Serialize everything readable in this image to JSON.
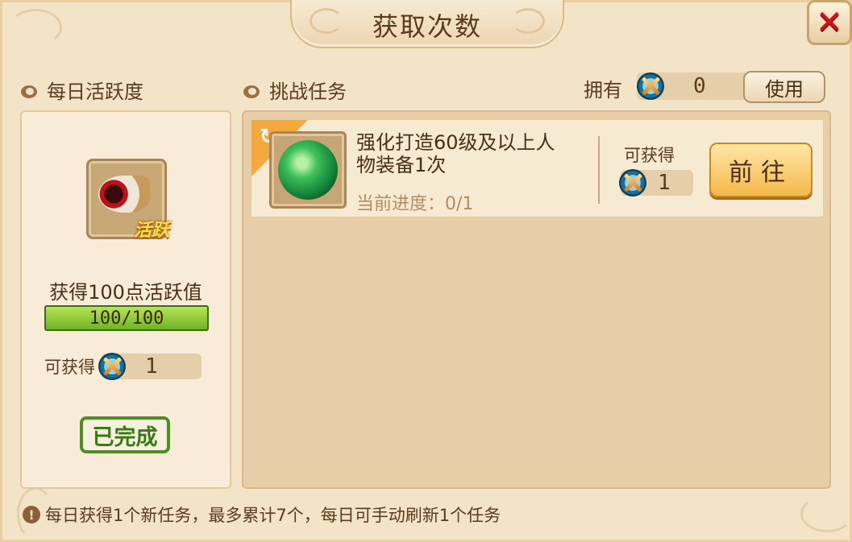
{
  "window": {
    "title": "获取次数",
    "close_icon": "close-icon"
  },
  "left_panel": {
    "header": "每日活跃度",
    "reward_icon_tag": "活跃",
    "reward_title": "获得100点活跃值",
    "progress": {
      "text": "100/100",
      "value": 100,
      "max": 100
    },
    "gain_label": "可获得",
    "gain_value": "1",
    "status_button": "已完成"
  },
  "right_panel": {
    "header": "挑战任务",
    "own_label": "拥有",
    "own_value": "0",
    "use_button": "使用",
    "tasks": [
      {
        "title": "强化打造60级及以上人物装备1次",
        "progress": "当前进度：0/1",
        "gain_label": "可获得",
        "gain_value": "1",
        "go_button": "前往"
      }
    ]
  },
  "footer": {
    "note": "每日获得1个新任务，最多累计7个，每日可手动刷新1个任务"
  },
  "colors": {
    "panel_bg": "#f3e4c8",
    "accent_green": "#4e8e22",
    "close_red": "#d41414",
    "go_button": "#f5b84a"
  }
}
